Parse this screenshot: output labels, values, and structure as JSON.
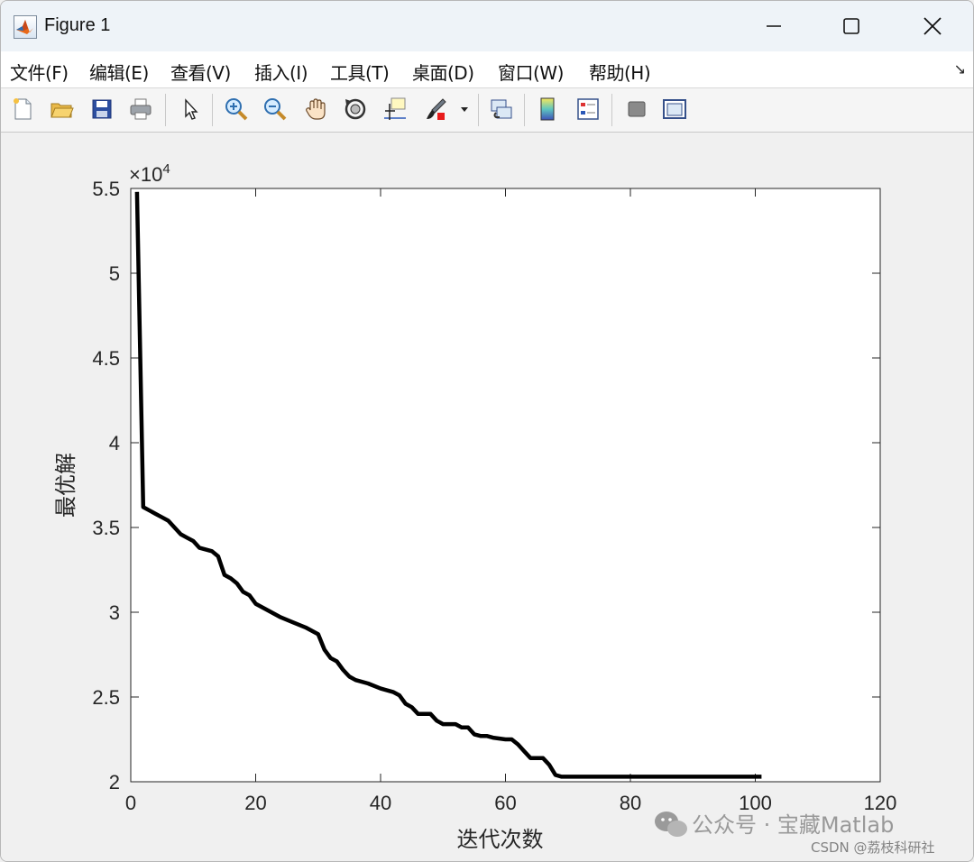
{
  "window": {
    "title": "Figure 1"
  },
  "menu": {
    "items": [
      "文件(F)",
      "编辑(E)",
      "查看(V)",
      "插入(I)",
      "工具(T)",
      "桌面(D)",
      "窗口(W)",
      "帮助(H)"
    ]
  },
  "toolbar": {
    "buttons": [
      "new-figure-icon",
      "open-file-icon",
      "save-icon",
      "print-icon",
      "pointer-icon",
      "zoom-in-icon",
      "zoom-out-icon",
      "pan-icon",
      "rotate-3d-icon",
      "data-cursor-icon",
      "brush-icon",
      "link-plot-icon",
      "colorbar-icon",
      "legend-icon",
      "hide-plot-tools-icon",
      "show-plot-tools-icon"
    ]
  },
  "chart_data": {
    "type": "line",
    "title": "",
    "xlabel": "迭代次数",
    "ylabel": "最优解",
    "exponent_label": "×10",
    "exponent_sup": "4",
    "xlim": [
      0,
      120
    ],
    "ylim": [
      2,
      5.5
    ],
    "xticks": [
      0,
      20,
      40,
      60,
      80,
      100,
      120
    ],
    "yticks": [
      2,
      2.5,
      3,
      3.5,
      4,
      4.5,
      5,
      5.5
    ],
    "ytick_labels": [
      "2",
      "2.5",
      "3",
      "3.5",
      "4",
      "4.5",
      "5",
      "5.5"
    ],
    "grid": false,
    "line_color": "#000000",
    "x": [
      1,
      2,
      3,
      4,
      5,
      6,
      7,
      8,
      9,
      10,
      11,
      12,
      13,
      14,
      15,
      16,
      17,
      18,
      19,
      20,
      22,
      24,
      26,
      28,
      30,
      31,
      32,
      33,
      34,
      35,
      36,
      38,
      40,
      42,
      43,
      44,
      45,
      46,
      47,
      48,
      49,
      50,
      52,
      53,
      54,
      55,
      56,
      57,
      58,
      60,
      61,
      62,
      63,
      64,
      65,
      66,
      67,
      68,
      69,
      70,
      80,
      90,
      101
    ],
    "y": [
      5.48,
      3.62,
      3.6,
      3.58,
      3.56,
      3.54,
      3.5,
      3.46,
      3.44,
      3.42,
      3.38,
      3.37,
      3.36,
      3.33,
      3.22,
      3.2,
      3.17,
      3.12,
      3.1,
      3.05,
      3.01,
      2.97,
      2.94,
      2.91,
      2.87,
      2.78,
      2.73,
      2.71,
      2.66,
      2.62,
      2.6,
      2.58,
      2.55,
      2.53,
      2.51,
      2.46,
      2.44,
      2.4,
      2.4,
      2.4,
      2.36,
      2.34,
      2.34,
      2.32,
      2.32,
      2.28,
      2.27,
      2.27,
      2.26,
      2.25,
      2.25,
      2.22,
      2.18,
      2.14,
      2.14,
      2.14,
      2.1,
      2.04,
      2.03,
      2.03,
      2.03,
      2.03,
      2.03
    ]
  },
  "watermark": {
    "account": "公众号 · 宝藏Matlab",
    "source": "CSDN @荔枝科研社"
  }
}
